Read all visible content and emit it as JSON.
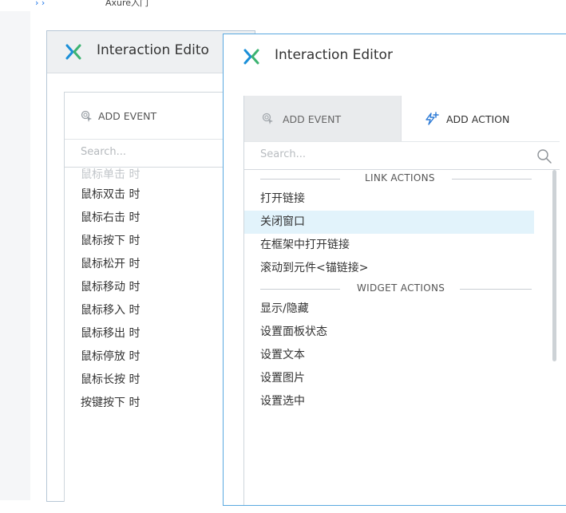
{
  "top_strip": {
    "nav_text": "› ›",
    "crumb": "Axure入门"
  },
  "back_editor": {
    "title": "Interaction Edito",
    "add_event_label": "ADD EVENT",
    "search_placeholder": "Search...",
    "events": [
      "鼠标单击 时",
      "鼠标双击 时",
      "鼠标右击 时",
      "鼠标按下 时",
      "鼠标松开 时",
      "鼠标移动 时",
      "鼠标移入 时",
      "鼠标移出 时",
      "鼠标停放 时",
      "鼠标长按 时",
      "按键按下 时"
    ]
  },
  "front_editor": {
    "title": "Interaction Editor",
    "tabs": {
      "add_event": "ADD EVENT",
      "add_action": "ADD ACTION"
    },
    "search_placeholder": "Search...",
    "sections": {
      "link_actions": "LINK ACTIONS",
      "widget_actions": "WIDGET ACTIONS"
    },
    "link_actions": [
      "打开链接",
      "关闭窗口",
      "在框架中打开链接",
      "滚动到元件<锚链接>"
    ],
    "widget_actions": [
      "显示/隐藏",
      "设置面板状态",
      "设置文本",
      "设置图片",
      "设置选中"
    ],
    "selected_action": "关闭窗口"
  },
  "colors": {
    "logo_blue": "#1a8fd8",
    "logo_green": "#3cb371",
    "selected_row": "#e2f3fb",
    "action_icon": "#2e7bd6"
  },
  "icons": {
    "logo": "axure-x-logo-icon",
    "add_event": "cursor-click-icon",
    "add_action": "lightning-plus-icon",
    "search": "search-icon"
  }
}
